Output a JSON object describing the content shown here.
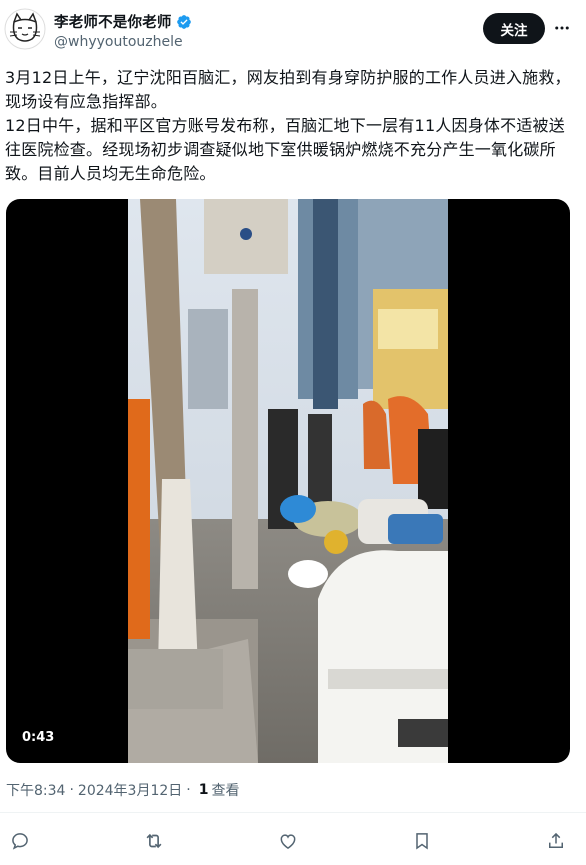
{
  "author": {
    "display_name": "李老师不是你老师",
    "handle": "@whyyoutouzhele",
    "verified": true
  },
  "header": {
    "follow_label": "关注",
    "more_icon": "more-horizontal-icon"
  },
  "tweet": {
    "text": "3月12日上午，辽宁沈阳百脑汇，网友拍到有身穿防护服的工作人员进入施救，现场设有应急指挥部。\n12日中午，据和平区官方账号发布称，百脑汇地下一层有11人因身体不适被送往医院检查。经现场初步调查疑似地下室供暖锅炉燃烧不充分产生一氧化碳所致。目前人员均无生命危险。"
  },
  "media": {
    "type": "video",
    "duration": "0:43"
  },
  "meta": {
    "time": "下午8:34",
    "date": "2024年3月12日",
    "views_count": "1",
    "views_label": "查看"
  },
  "actions": [
    {
      "name": "reply",
      "icon": "reply-icon"
    },
    {
      "name": "repost",
      "icon": "repost-icon"
    },
    {
      "name": "like",
      "icon": "like-icon"
    },
    {
      "name": "bookmark",
      "icon": "bookmark-icon"
    },
    {
      "name": "share",
      "icon": "share-icon"
    }
  ],
  "colors": {
    "text": "#0f1419",
    "secondary": "#536471",
    "verified_blue": "#1d9bf0",
    "button_bg": "#0f1419"
  }
}
